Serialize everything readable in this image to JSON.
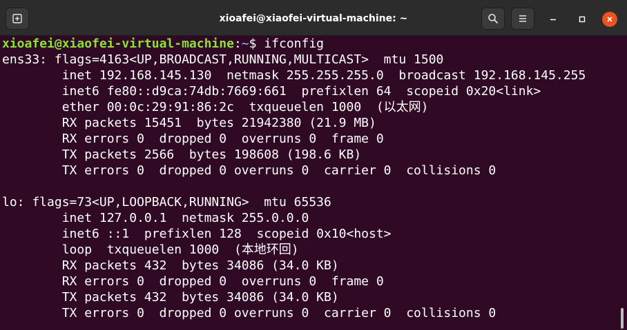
{
  "window": {
    "title": "xioafei@xiaofei-virtual-machine: ~"
  },
  "titlebar": {
    "icons": {
      "new_tab": "new-tab-icon",
      "search": "search-icon",
      "menu": "hamburger-menu-icon",
      "minimize": "minimize-icon",
      "maximize": "maximize-icon",
      "close": "close-icon"
    },
    "colors": {
      "background": "#2c2c2c",
      "close_accent": "#e95420"
    }
  },
  "terminal": {
    "colors": {
      "background": "#300a24",
      "text": "#ffffff",
      "prompt_user": "#8ae234",
      "prompt_path": "#729fcf"
    },
    "prompt": {
      "user_host": "xioafei@xiaofei-virtual-machine",
      "separator": ":",
      "path": "~",
      "symbol": "$ ",
      "command": "ifconfig"
    },
    "output": [
      "ens33: flags=4163<UP,BROADCAST,RUNNING,MULTICAST>  mtu 1500",
      "        inet 192.168.145.130  netmask 255.255.255.0  broadcast 192.168.145.255",
      "        inet6 fe80::d9ca:74db:7669:661  prefixlen 64  scopeid 0x20<link>",
      "        ether 00:0c:29:91:86:2c  txqueuelen 1000  (以太网)",
      "        RX packets 15451  bytes 21942380 (21.9 MB)",
      "        RX errors 0  dropped 0  overruns 0  frame 0",
      "        TX packets 2566  bytes 198608 (198.6 KB)",
      "        TX errors 0  dropped 0 overruns 0  carrier 0  collisions 0",
      "",
      "lo: flags=73<UP,LOOPBACK,RUNNING>  mtu 65536",
      "        inet 127.0.0.1  netmask 255.0.0.0",
      "        inet6 ::1  prefixlen 128  scopeid 0x10<host>",
      "        loop  txqueuelen 1000  (本地环回)",
      "        RX packets 432  bytes 34086 (34.0 KB)",
      "        RX errors 0  dropped 0  overruns 0  frame 0",
      "        TX packets 432  bytes 34086 (34.0 KB)",
      "        TX errors 0  dropped 0 overruns 0  carrier 0  collisions 0"
    ]
  }
}
